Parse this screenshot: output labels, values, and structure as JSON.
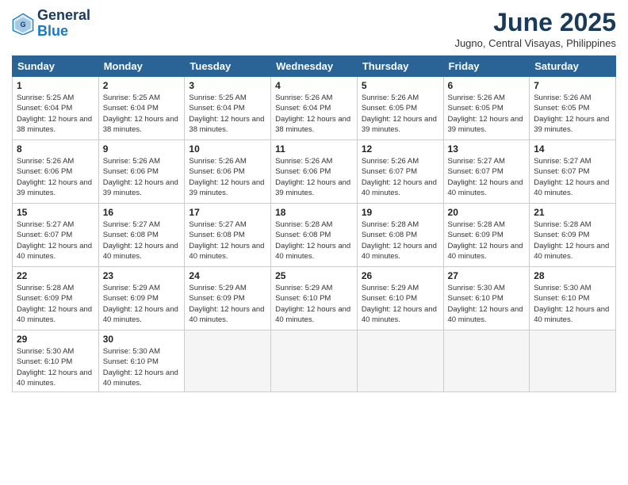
{
  "logo": {
    "line1": "General",
    "line2": "Blue"
  },
  "title": "June 2025",
  "location": "Jugno, Central Visayas, Philippines",
  "weekdays": [
    "Sunday",
    "Monday",
    "Tuesday",
    "Wednesday",
    "Thursday",
    "Friday",
    "Saturday"
  ],
  "days": [
    {
      "day": "",
      "info": ""
    },
    {
      "day": "",
      "info": ""
    },
    {
      "day": "",
      "info": ""
    },
    {
      "day": "",
      "info": ""
    },
    {
      "day": "",
      "info": ""
    },
    {
      "day": "",
      "info": ""
    },
    {
      "day": "",
      "info": ""
    },
    {
      "day": "1",
      "sunrise": "5:25 AM",
      "sunset": "6:04 PM",
      "daylight": "12 hours and 38 minutes."
    },
    {
      "day": "2",
      "sunrise": "5:25 AM",
      "sunset": "6:04 PM",
      "daylight": "12 hours and 38 minutes."
    },
    {
      "day": "3",
      "sunrise": "5:25 AM",
      "sunset": "6:04 PM",
      "daylight": "12 hours and 38 minutes."
    },
    {
      "day": "4",
      "sunrise": "5:26 AM",
      "sunset": "6:04 PM",
      "daylight": "12 hours and 38 minutes."
    },
    {
      "day": "5",
      "sunrise": "5:26 AM",
      "sunset": "6:05 PM",
      "daylight": "12 hours and 39 minutes."
    },
    {
      "day": "6",
      "sunrise": "5:26 AM",
      "sunset": "6:05 PM",
      "daylight": "12 hours and 39 minutes."
    },
    {
      "day": "7",
      "sunrise": "5:26 AM",
      "sunset": "6:05 PM",
      "daylight": "12 hours and 39 minutes."
    },
    {
      "day": "8",
      "sunrise": "5:26 AM",
      "sunset": "6:06 PM",
      "daylight": "12 hours and 39 minutes."
    },
    {
      "day": "9",
      "sunrise": "5:26 AM",
      "sunset": "6:06 PM",
      "daylight": "12 hours and 39 minutes."
    },
    {
      "day": "10",
      "sunrise": "5:26 AM",
      "sunset": "6:06 PM",
      "daylight": "12 hours and 39 minutes."
    },
    {
      "day": "11",
      "sunrise": "5:26 AM",
      "sunset": "6:06 PM",
      "daylight": "12 hours and 39 minutes."
    },
    {
      "day": "12",
      "sunrise": "5:26 AM",
      "sunset": "6:07 PM",
      "daylight": "12 hours and 40 minutes."
    },
    {
      "day": "13",
      "sunrise": "5:27 AM",
      "sunset": "6:07 PM",
      "daylight": "12 hours and 40 minutes."
    },
    {
      "day": "14",
      "sunrise": "5:27 AM",
      "sunset": "6:07 PM",
      "daylight": "12 hours and 40 minutes."
    },
    {
      "day": "15",
      "sunrise": "5:27 AM",
      "sunset": "6:07 PM",
      "daylight": "12 hours and 40 minutes."
    },
    {
      "day": "16",
      "sunrise": "5:27 AM",
      "sunset": "6:08 PM",
      "daylight": "12 hours and 40 minutes."
    },
    {
      "day": "17",
      "sunrise": "5:27 AM",
      "sunset": "6:08 PM",
      "daylight": "12 hours and 40 minutes."
    },
    {
      "day": "18",
      "sunrise": "5:28 AM",
      "sunset": "6:08 PM",
      "daylight": "12 hours and 40 minutes."
    },
    {
      "day": "19",
      "sunrise": "5:28 AM",
      "sunset": "6:08 PM",
      "daylight": "12 hours and 40 minutes."
    },
    {
      "day": "20",
      "sunrise": "5:28 AM",
      "sunset": "6:09 PM",
      "daylight": "12 hours and 40 minutes."
    },
    {
      "day": "21",
      "sunrise": "5:28 AM",
      "sunset": "6:09 PM",
      "daylight": "12 hours and 40 minutes."
    },
    {
      "day": "22",
      "sunrise": "5:28 AM",
      "sunset": "6:09 PM",
      "daylight": "12 hours and 40 minutes."
    },
    {
      "day": "23",
      "sunrise": "5:29 AM",
      "sunset": "6:09 PM",
      "daylight": "12 hours and 40 minutes."
    },
    {
      "day": "24",
      "sunrise": "5:29 AM",
      "sunset": "6:09 PM",
      "daylight": "12 hours and 40 minutes."
    },
    {
      "day": "25",
      "sunrise": "5:29 AM",
      "sunset": "6:10 PM",
      "daylight": "12 hours and 40 minutes."
    },
    {
      "day": "26",
      "sunrise": "5:29 AM",
      "sunset": "6:10 PM",
      "daylight": "12 hours and 40 minutes."
    },
    {
      "day": "27",
      "sunrise": "5:30 AM",
      "sunset": "6:10 PM",
      "daylight": "12 hours and 40 minutes."
    },
    {
      "day": "28",
      "sunrise": "5:30 AM",
      "sunset": "6:10 PM",
      "daylight": "12 hours and 40 minutes."
    },
    {
      "day": "29",
      "sunrise": "5:30 AM",
      "sunset": "6:10 PM",
      "daylight": "12 hours and 40 minutes."
    },
    {
      "day": "30",
      "sunrise": "5:30 AM",
      "sunset": "6:10 PM",
      "daylight": "12 hours and 40 minutes."
    },
    {
      "day": "",
      "info": ""
    },
    {
      "day": "",
      "info": ""
    },
    {
      "day": "",
      "info": ""
    },
    {
      "day": "",
      "info": ""
    },
    {
      "day": "",
      "info": ""
    }
  ]
}
